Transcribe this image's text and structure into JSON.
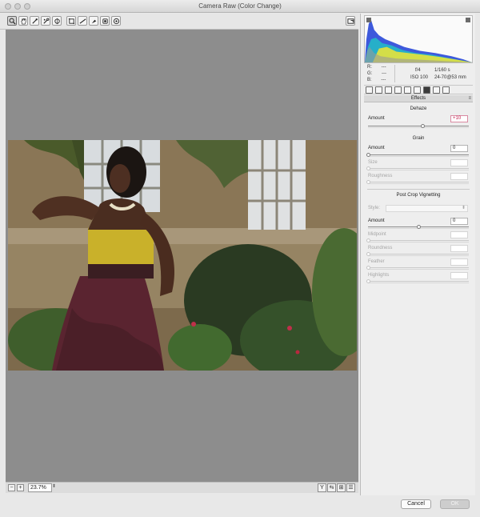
{
  "window": {
    "title": "Camera Raw (Color Change)"
  },
  "toolbar": {
    "tools": [
      "zoom-icon",
      "hand-icon",
      "white-balance-icon",
      "color-sampler-icon",
      "targeted-adjustment-icon",
      "crop-icon",
      "straighten-icon",
      "spot-removal-icon",
      "red-eye-icon",
      "adjustment-brush-icon",
      "graduated-filter-icon",
      "radial-filter-icon"
    ],
    "active_tool": "zoom-icon"
  },
  "camera_info": {
    "r_label": "R:",
    "r_value": "---",
    "g_label": "G:",
    "g_value": "---",
    "b_label": "B:",
    "b_value": "---",
    "aperture": "f/4",
    "shutter": "1/160 s",
    "iso": "ISO 100",
    "lens": "24-70@53 mm"
  },
  "panel": {
    "section_title": "Effects",
    "dehaze": {
      "title": "Dehaze",
      "amount_label": "Amount",
      "amount_value": "+10",
      "amount": 10
    },
    "grain": {
      "title": "Grain",
      "amount_label": "Amount",
      "amount_value": "0",
      "size_label": "Size",
      "size_value": "",
      "roughness_label": "Roughness",
      "roughness_value": ""
    },
    "vignette": {
      "title": "Post Crop Vignetting",
      "style_label": "Style:",
      "amount_label": "Amount",
      "amount_value": "0",
      "midpoint_label": "Midpoint",
      "roundness_label": "Roundness",
      "feather_label": "Feather",
      "highlights_label": "Highlights"
    }
  },
  "statusbar": {
    "zoom": "23.7%"
  },
  "buttons": {
    "cancel": "Cancel",
    "ok": "OK"
  },
  "colors": {
    "dehaze_positive": "#c21f4d",
    "preview_bg": "#8d8d8d"
  }
}
